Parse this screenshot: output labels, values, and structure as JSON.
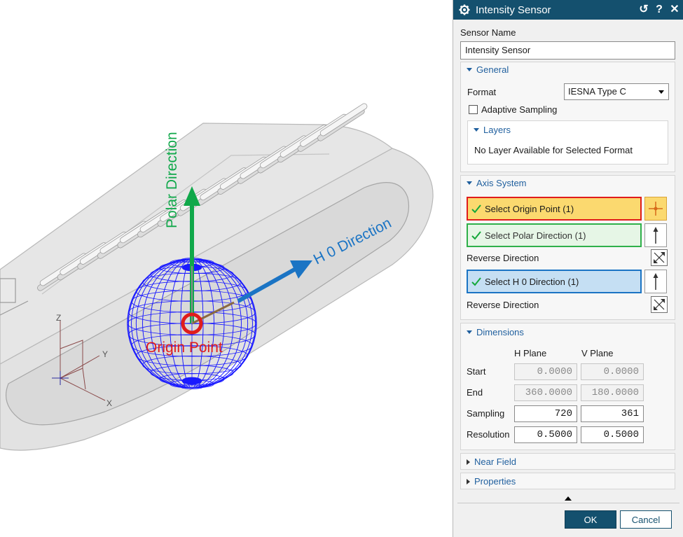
{
  "viewport": {
    "labels": {
      "polar": "Polar Direction",
      "h0": "H 0 Direction",
      "origin": "Origin Point"
    },
    "triad": {
      "z": "Z",
      "y": "Y",
      "x": "X"
    },
    "colors": {
      "polar": "#10a84a",
      "h0": "#1b74c4",
      "origin": "#e01c1c",
      "sphere": "#1a1aff"
    }
  },
  "dialog": {
    "title": "Intensity Sensor",
    "title_icons": [
      "reset-icon",
      "help-icon",
      "close-icon"
    ],
    "sensor_name_label": "Sensor Name",
    "sensor_name_value": "Intensity Sensor",
    "general": {
      "header": "General",
      "format_label": "Format",
      "format_value": "IESNA Type C",
      "adaptive_sampling_label": "Adaptive Sampling",
      "adaptive_sampling_checked": false,
      "layers": {
        "header": "Layers",
        "message": "No Layer Available for Selected Format"
      }
    },
    "axis_system": {
      "header": "Axis System",
      "select_origin": "Select Origin Point (1)",
      "select_polar": "Select Polar Direction (1)",
      "reverse_direction_1": "Reverse Direction",
      "select_h0": "Select H 0 Direction (1)",
      "reverse_direction_2": "Reverse Direction"
    },
    "dimensions": {
      "header": "Dimensions",
      "col_h": "H Plane",
      "col_v": "V Plane",
      "rows": [
        {
          "label": "Start",
          "h": "0.0000",
          "v": "0.0000",
          "enabled": false
        },
        {
          "label": "End",
          "h": "360.0000",
          "v": "180.0000",
          "enabled": false
        },
        {
          "label": "Sampling",
          "h": "720",
          "v": "361",
          "enabled": true
        },
        {
          "label": "Resolution",
          "h": "0.5000",
          "v": "0.5000",
          "enabled": true
        }
      ]
    },
    "near_field": {
      "header": "Near Field"
    },
    "properties": {
      "header": "Properties"
    },
    "ok_label": "OK",
    "cancel_label": "Cancel"
  }
}
